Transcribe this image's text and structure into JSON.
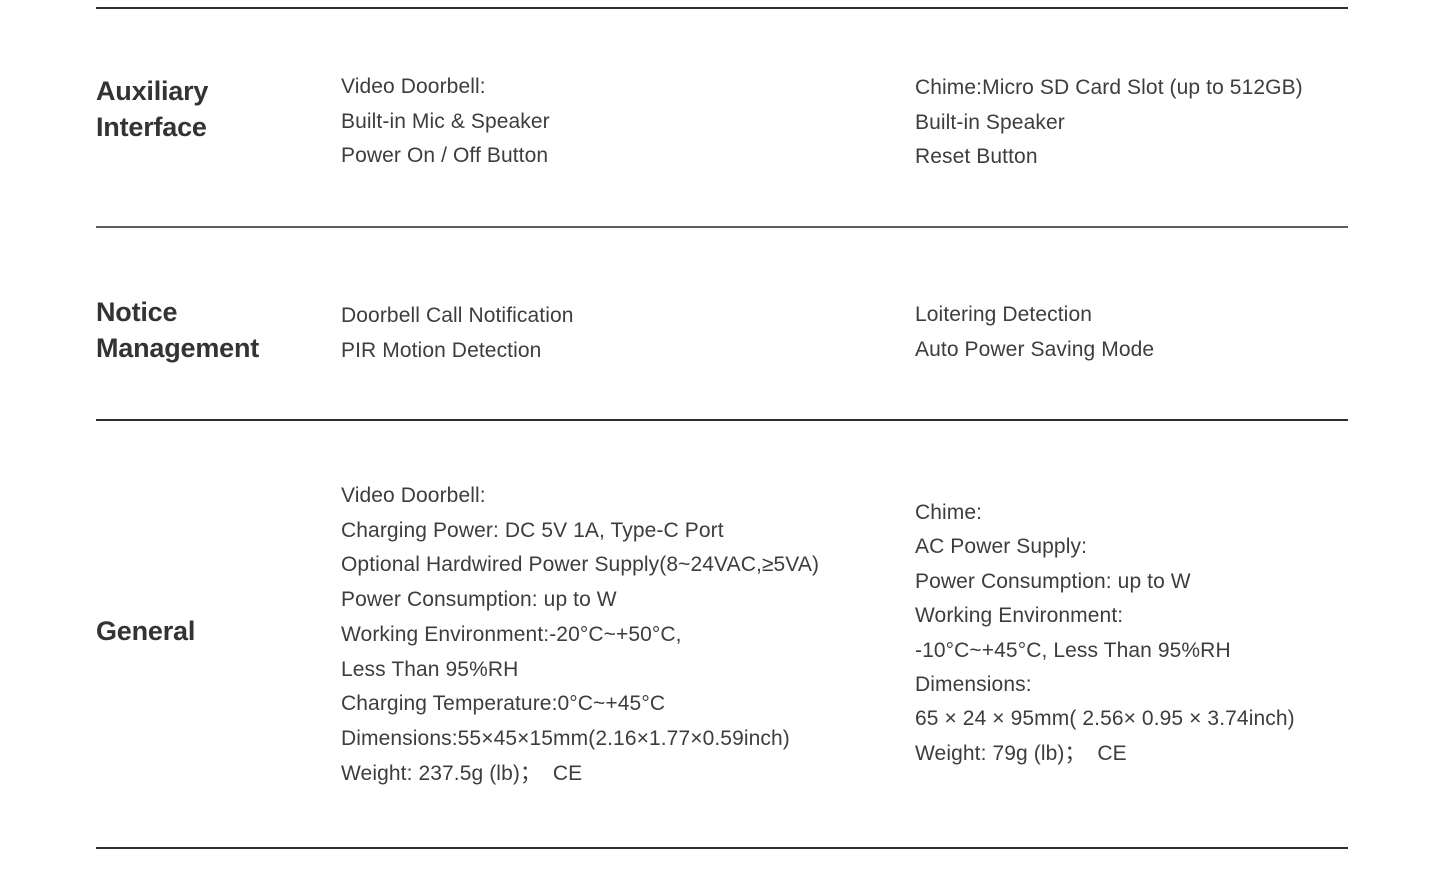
{
  "document": {
    "type": "product-specification-table",
    "columns": 3,
    "text_color": "#3d3d3d",
    "heading_color": "#333333",
    "background_color": "#ffffff",
    "divider_color_dark": "#2e2e2e",
    "divider_color_mid": "#5d5d5d"
  },
  "sections": [
    {
      "id": "auxiliary-interface",
      "label": "Auxiliary\nInterface",
      "label_line1": "Auxiliary",
      "label_line2": "Interface",
      "primary": {
        "items": [
          "Video Doorbell:",
          "Built-in Mic & Speaker",
          "Power On / Off Button"
        ]
      },
      "secondary": {
        "items": [
          "Chime:Micro SD Card Slot (up to 512GB)",
          "Built-in Speaker",
          "Reset Button"
        ]
      }
    },
    {
      "id": "notice-management",
      "label": "Notice\nManagement",
      "label_line1": "Notice",
      "label_line2": "Management",
      "primary": {
        "items": [
          "Doorbell Call Notification",
          "PIR Motion Detection"
        ]
      },
      "secondary": {
        "items": [
          "Loitering Detection",
          "Auto Power Saving Mode"
        ]
      }
    },
    {
      "id": "general",
      "label": "General",
      "label_line1": "General",
      "label_line2": "",
      "primary": {
        "items": [
          "Video Doorbell:",
          "Charging Power: DC 5V 1A, Type-C Port",
          "Optional Hardwired Power Supply(8~24VAC,≥5VA)",
          "Power Consumption: up to W",
          "Working Environment:-20°C~+50°C,",
          "Less Than 95%RH",
          "Charging Temperature:0°C~+45°C",
          "Dimensions:55×45×15mm(2.16×1.77×0.59inch)",
          "Weight: 237.5g (lb)；  CE"
        ]
      },
      "secondary": {
        "items": [
          "Chime:",
          "AC Power Supply:",
          "Power Consumption: up to W",
          "Working Environment:",
          "-10°C~+45°C, Less Than 95%RH",
          "Dimensions:",
          "65 × 24 × 95mm( 2.56× 0.95 × 3.74inch)",
          "Weight: 79g (lb)；  CE"
        ]
      }
    }
  ]
}
